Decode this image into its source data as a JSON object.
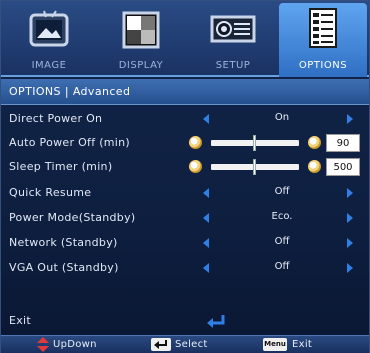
{
  "tabs": [
    {
      "label": "IMAGE",
      "icon": "image-icon",
      "active": false
    },
    {
      "label": "DISPLAY",
      "icon": "display-icon",
      "active": false
    },
    {
      "label": "SETUP",
      "icon": "projector-icon",
      "active": false
    },
    {
      "label": "OPTIONS",
      "icon": "options-list-icon",
      "active": true
    }
  ],
  "breadcrumb": "OPTIONS  |  Advanced",
  "items": [
    {
      "name": "Direct Power On",
      "value": "On"
    },
    {
      "name": "Auto Power Off (min)",
      "value": "90",
      "level": 0.5
    },
    {
      "name": "Sleep Timer (min)",
      "value": "500",
      "level": 0.5
    },
    {
      "name": "Quick Resume",
      "value": "Off"
    },
    {
      "name": "Power Mode(Standby)",
      "value": "Eco."
    },
    {
      "name": "Network (Standby)",
      "value": "Off"
    },
    {
      "name": "VGA Out (Standby)",
      "value": "Off"
    }
  ],
  "exit": {
    "label": "Exit"
  },
  "footer": {
    "updown_label": "UpDown",
    "select_label": "Select",
    "menu_key_label": "Menu",
    "exit_label": "Exit"
  },
  "colors": {
    "accent": "#2f7fe6",
    "active_tab": "#4a90e2",
    "background": "#0e1f40"
  }
}
